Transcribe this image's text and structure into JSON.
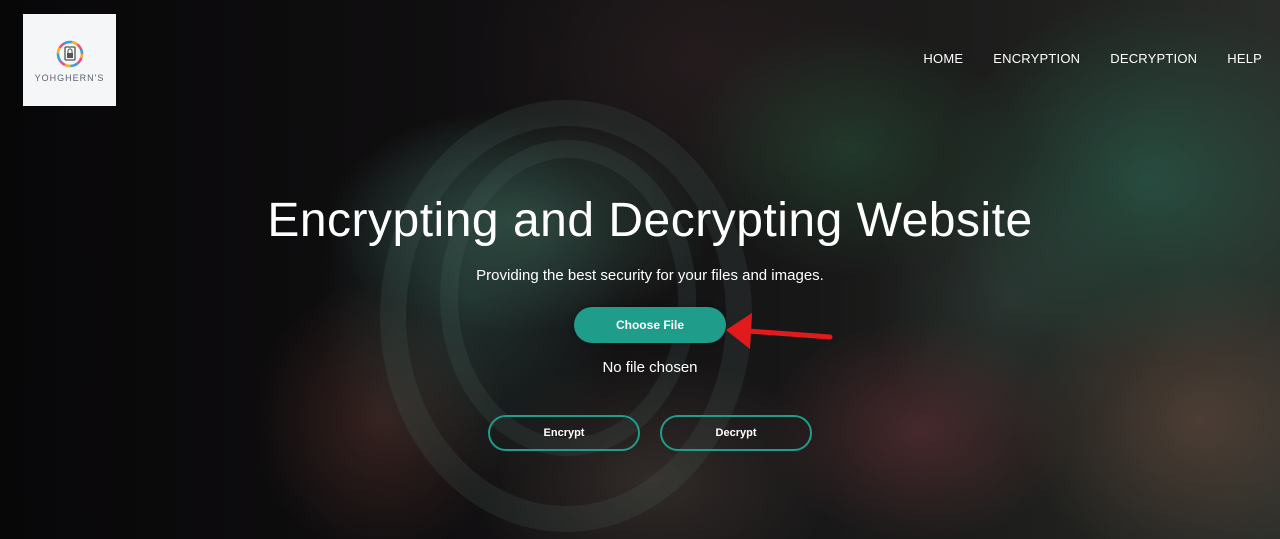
{
  "brand": {
    "name": "YOHGHERN'S",
    "tagline": "",
    "accent": "#1f9c8a"
  },
  "nav": {
    "items": [
      {
        "label": "HOME"
      },
      {
        "label": "ENCRYPTION"
      },
      {
        "label": "DECRYPTION"
      },
      {
        "label": "HELP"
      }
    ]
  },
  "hero": {
    "title": "Encrypting and Decrypting Website",
    "subtitle": "Providing the best security for your files and images."
  },
  "file_input": {
    "button_label": "Choose File",
    "status": "No file chosen"
  },
  "actions": {
    "encrypt_label": "Encrypt",
    "decrypt_label": "Decrypt"
  },
  "annotation": {
    "arrow_color": "#e11b1b",
    "icon": "red-arrow-pointing-left"
  }
}
